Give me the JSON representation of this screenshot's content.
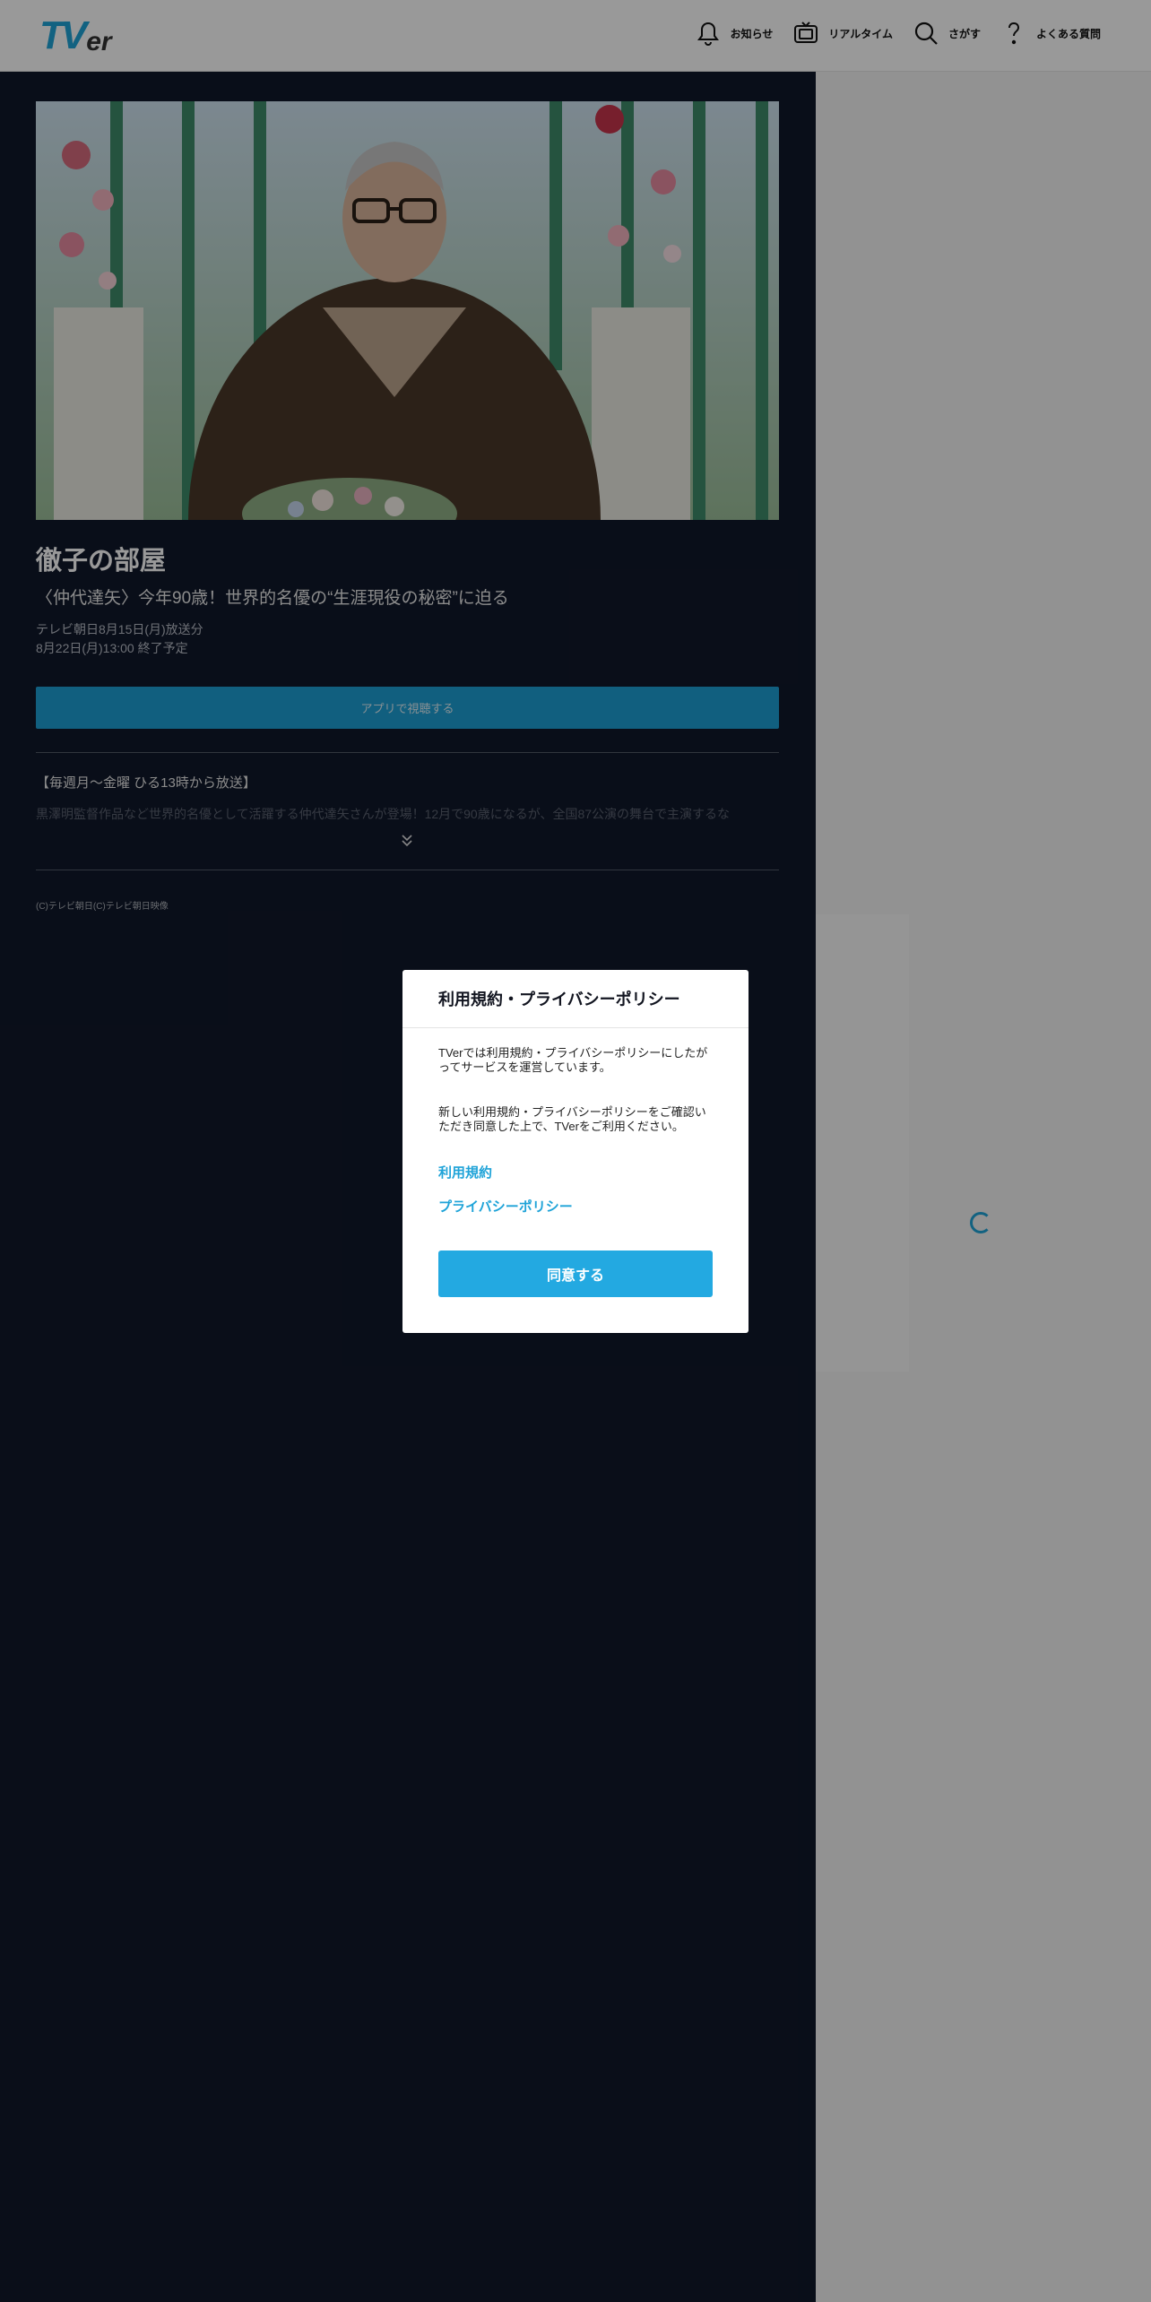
{
  "header": {
    "logo_text_tv": "TV",
    "logo_text_er": "er",
    "nav": [
      {
        "label": "お知らせ",
        "icon": "bell-icon"
      },
      {
        "label": "リアルタイム",
        "icon": "tv-icon"
      },
      {
        "label": "さがす",
        "icon": "search-icon"
      },
      {
        "label": "よくある質問",
        "icon": "question-icon"
      }
    ]
  },
  "episode": {
    "title": "徹子の部屋",
    "subtitle": "〈仲代達矢〉今年90歳！世界的名優の“生涯現役の秘密”に迫る",
    "broadcast": "テレビ朝日8月15日(月)放送分",
    "end_date": "8月22日(月)13:00 終了予定",
    "app_button": "アプリで視聴する",
    "description_heading": "【毎週月～金曜 ひる13時から放送】",
    "description_preview": "黒澤明監督作品など世界的名優として活躍する仲代達矢さんが登場！12月で90歳になるが、全国87公演の舞台で主演するな",
    "copyright": "(C)テレビ朝日(C)テレビ朝日映像"
  },
  "modal": {
    "title": "利用規約・プライバシーポリシー",
    "text1": "TVerでは利用規約・プライバシーポリシーにしたがってサービスを運営しています。",
    "text2": "新しい利用規約・プライバシーポリシーをご確認いただき同意した上で、TVerをご利用ください。",
    "link_terms": "利用規約",
    "link_privacy": "プライバシーポリシー",
    "agree_button": "同意する"
  },
  "colors": {
    "accent": "#1ea3d8",
    "main_bg": "#10182a"
  }
}
